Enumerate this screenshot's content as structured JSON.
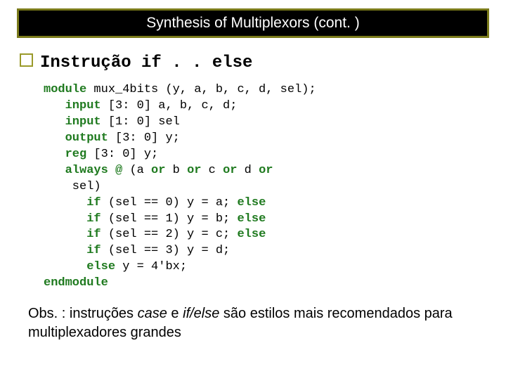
{
  "title": "Synthesis of Multiplexors (cont. )",
  "section": "Instrução if . . else",
  "code": {
    "l1a": "module",
    "l1b": " mux_4bits (y, a, b, c, d, sel);",
    "l2a": "input",
    "l2b": " [3: 0] a, b, c, d;",
    "l3a": "input",
    "l3b": " [1: 0] sel",
    "l4a": "output",
    "l4b": " [3: 0] y;",
    "l5a": "reg",
    "l5b": " [3: 0] y;",
    "l6a": "always",
    "l6b": " @ ",
    "l6c": "(a ",
    "l6d": "or",
    "l6e": " b ",
    "l6f": "or",
    "l6g": " c ",
    "l6h": "or",
    "l6i": " d ",
    "l6j": "or",
    "l7": " sel)",
    "l8a": "if",
    "l8b": " (sel == 0) y = a; ",
    "l8c": "else",
    "l9a": "if",
    "l9b": " (sel == 1) y = b; ",
    "l9c": "else",
    "l10a": "if",
    "l10b": " (sel == 2) y = c; ",
    "l10c": "else",
    "l11a": "if",
    "l11b": " (sel == 3) y = d;",
    "l12a": "else",
    "l12b": " y = 4'bx;",
    "l13": "endmodule"
  },
  "note": {
    "p1": "Obs. : instruções ",
    "i1": "case",
    "p2": " e ",
    "i2": "if/else",
    "p3": " são estilos mais recomendados para multiplexadores grandes"
  }
}
